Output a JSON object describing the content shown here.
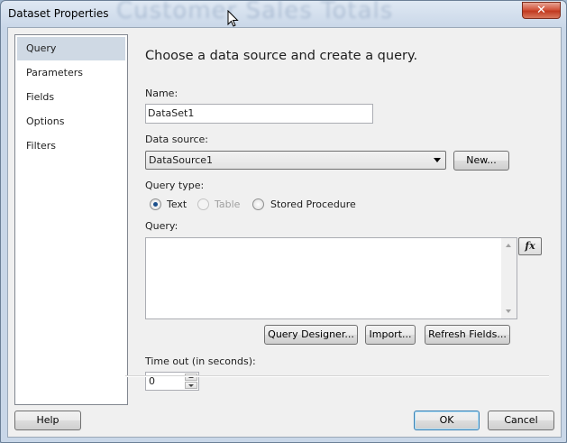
{
  "window": {
    "title": "Dataset Properties",
    "background_title": "Customer Sales Totals",
    "close_glyph": "✕"
  },
  "nav": {
    "items": [
      {
        "label": "Query",
        "selected": true
      },
      {
        "label": "Parameters"
      },
      {
        "label": "Fields"
      },
      {
        "label": "Options"
      },
      {
        "label": "Filters"
      }
    ]
  },
  "main": {
    "heading": "Choose a data source and create a query.",
    "name_label": "Name:",
    "name_value": "DataSet1",
    "datasource_label": "Data source:",
    "datasource_value": "DataSource1",
    "new_button": "New...",
    "query_type_label": "Query type:",
    "query_types": [
      {
        "label": "Text",
        "checked": true,
        "enabled": true
      },
      {
        "label": "Table",
        "checked": false,
        "enabled": false
      },
      {
        "label": "Stored Procedure",
        "checked": false,
        "enabled": true
      }
    ],
    "query_label": "Query:",
    "query_value": "",
    "fx_button": "fx",
    "query_designer_button": "Query Designer...",
    "import_button": "Import...",
    "refresh_button": "Refresh Fields...",
    "timeout_label": "Time out (in seconds):",
    "timeout_value": "0"
  },
  "footer": {
    "help_button": "Help",
    "ok_button": "OK",
    "cancel_button": "Cancel"
  }
}
